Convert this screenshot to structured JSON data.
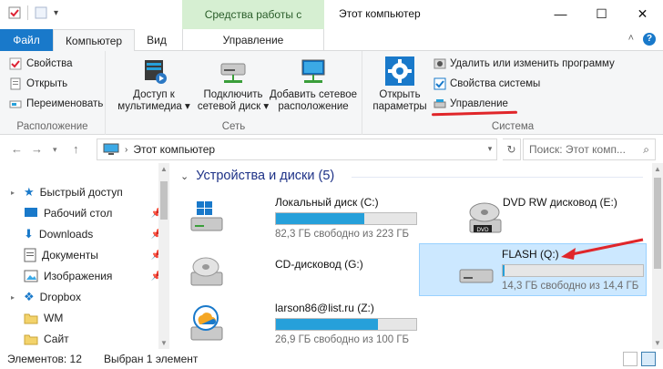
{
  "title_bar": {
    "window_title": "Этот компьютер",
    "context_tab_group": "Средства работы с дисками",
    "controls": [
      "minimize",
      "maximize",
      "close"
    ]
  },
  "ribbon_tabs": {
    "file": "Файл",
    "computer": "Компьютер",
    "view": "Вид",
    "manage": "Управление"
  },
  "ribbon": {
    "location": {
      "label": "Расположение",
      "properties": "Свойства",
      "open": "Открыть",
      "rename": "Переименовать"
    },
    "network": {
      "label": "Сеть",
      "media_1": "Доступ к",
      "media_2": "мультимедиа",
      "map_1": "Подключить",
      "map_2": "сетевой диск",
      "add_1": "Добавить сетевое",
      "add_2": "расположение"
    },
    "system": {
      "label": "Система",
      "open_settings_1": "Открыть",
      "open_settings_2": "параметры",
      "uninstall": "Удалить или изменить программу",
      "sysprops": "Свойства системы",
      "manage": "Управление"
    }
  },
  "address": {
    "path": "Этот компьютер",
    "search_placeholder": "Поиск: Этот комп..."
  },
  "nav_pane": {
    "items": [
      {
        "label": "Быстрый доступ",
        "icon": "star-icon"
      },
      {
        "label": "Рабочий стол",
        "icon": "desktop-icon",
        "pinned": true
      },
      {
        "label": "Downloads",
        "icon": "download-icon",
        "pinned": true
      },
      {
        "label": "Документы",
        "icon": "documents-icon",
        "pinned": true
      },
      {
        "label": "Изображения",
        "icon": "pictures-icon",
        "pinned": true
      },
      {
        "label": "Dropbox",
        "icon": "dropbox-icon"
      },
      {
        "label": "WM",
        "icon": "folder-icon"
      },
      {
        "label": "Сайт",
        "icon": "folder-icon"
      }
    ]
  },
  "main": {
    "section_title": "Устройства и диски (5)",
    "drives": [
      {
        "name": "Локальный диск (C:)",
        "free": "82,3 ГБ свободно из 223 ГБ",
        "used_fraction": 0.63,
        "icon": "windows-drive-icon"
      },
      {
        "name": "DVD RW дисковод (E:)",
        "icon": "dvd-drive-icon"
      },
      {
        "name": "CD-дисковод (G:)",
        "icon": "cd-drive-icon"
      },
      {
        "name": "FLASH (Q:)",
        "free": "14,3 ГБ свободно из 14,4 ГБ",
        "used_fraction": 0.01,
        "icon": "flash-drive-icon",
        "selected": true
      },
      {
        "name": "larson86@list.ru (Z:)",
        "free": "26,9 ГБ свободно из 100 ГБ",
        "used_fraction": 0.73,
        "icon": "cloud-drive-icon"
      }
    ]
  },
  "status_bar": {
    "items_count": "Элементов: 12",
    "selected": "Выбран 1 элемент"
  },
  "colors": {
    "accent": "#1979ca",
    "context_tab": "#d6efd2",
    "bar_fill": "#26a0da",
    "selection": "#cce8ff",
    "annotation_red": "#e0262a"
  }
}
